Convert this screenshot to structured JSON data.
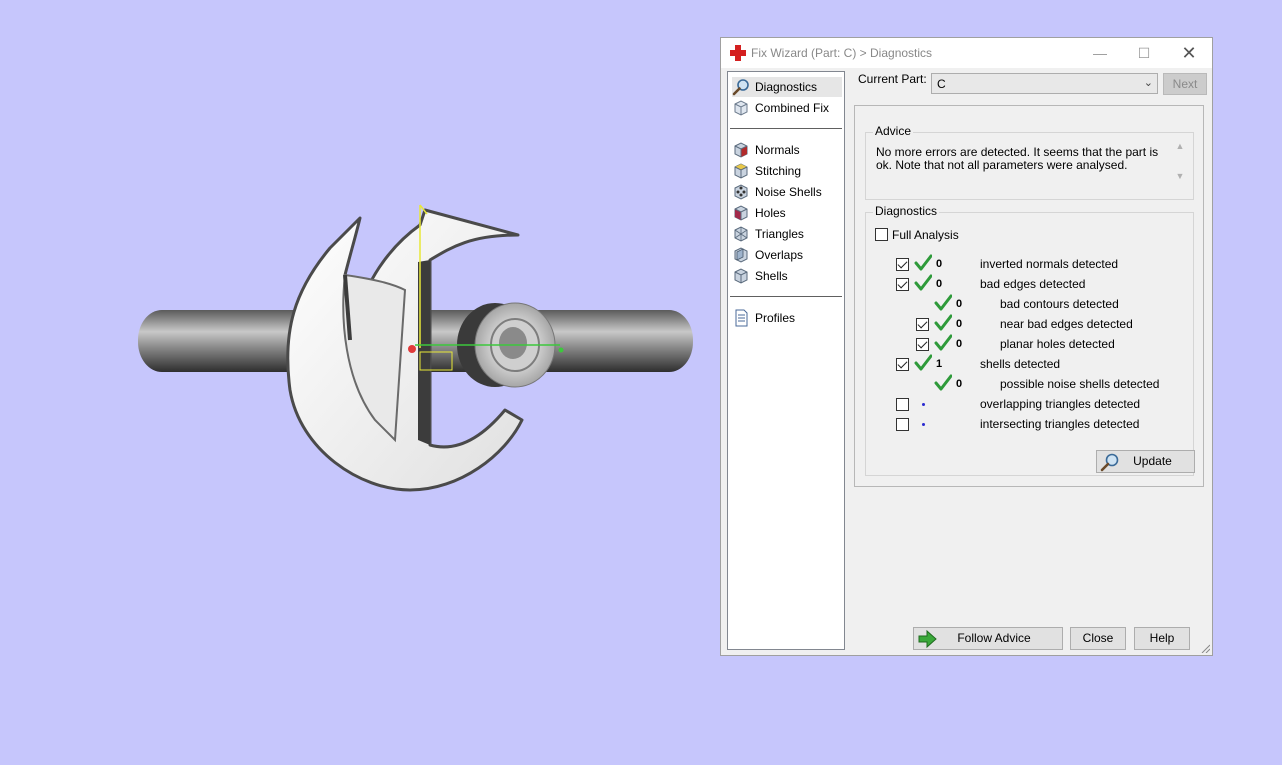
{
  "window": {
    "title": "Fix Wizard (Part: C) > Diagnostics",
    "minimize_glyph": "—",
    "maximize_glyph": "☐",
    "close_glyph": "✕"
  },
  "sidebar": {
    "top_items": [
      {
        "label": "Diagnostics",
        "icon": "magnifier-icon",
        "active": true
      },
      {
        "label": "Combined Fix",
        "icon": "cube-icon"
      }
    ],
    "fix_items": [
      {
        "label": "Normals",
        "icon": "normals-cube-icon"
      },
      {
        "label": "Stitching",
        "icon": "stitching-cube-icon"
      },
      {
        "label": "Noise Shells",
        "icon": "noise-shells-icon"
      },
      {
        "label": "Holes",
        "icon": "holes-cube-icon"
      },
      {
        "label": "Triangles",
        "icon": "triangles-cube-icon"
      },
      {
        "label": "Overlaps",
        "icon": "overlaps-cube-icon"
      },
      {
        "label": "Shells",
        "icon": "shells-cube-icon"
      }
    ],
    "bottom_items": [
      {
        "label": "Profiles",
        "icon": "document-icon"
      }
    ]
  },
  "current_part": {
    "label": "Current Part:",
    "value": "C",
    "next_label": "Next"
  },
  "advice": {
    "title": "Advice",
    "text": "No more errors are detected. It seems that the part is ok. Note that not all parameters were analysed."
  },
  "diagnostics": {
    "title": "Diagnostics",
    "full_analysis_label": "Full Analysis",
    "full_analysis_checked": false,
    "rows": [
      {
        "label": "inverted normals detected",
        "value": "0",
        "checked": true,
        "status": "ok",
        "indent": 0,
        "has_checkbox": true
      },
      {
        "label": "bad edges detected",
        "value": "0",
        "checked": true,
        "status": "ok",
        "indent": 0,
        "has_checkbox": true
      },
      {
        "label": "bad contours detected",
        "value": "0",
        "checked": false,
        "status": "ok",
        "indent": 1,
        "has_checkbox": false
      },
      {
        "label": "near bad edges detected",
        "value": "0",
        "checked": true,
        "status": "ok",
        "indent": 1,
        "has_checkbox": true
      },
      {
        "label": "planar holes detected",
        "value": "0",
        "checked": true,
        "status": "ok",
        "indent": 1,
        "has_checkbox": true
      },
      {
        "label": "shells detected",
        "value": "1",
        "checked": true,
        "status": "ok",
        "indent": 0,
        "has_checkbox": true
      },
      {
        "label": "possible noise shells detected",
        "value": "0",
        "checked": false,
        "status": "ok",
        "indent": 1,
        "has_checkbox": false
      },
      {
        "label": "overlapping triangles detected",
        "value": "",
        "checked": false,
        "status": "pending",
        "indent": 0,
        "has_checkbox": true
      },
      {
        "label": "intersecting triangles detected",
        "value": "",
        "checked": false,
        "status": "pending",
        "indent": 0,
        "has_checkbox": true
      }
    ],
    "update_label": "Update"
  },
  "footer": {
    "follow_advice_label": "Follow Advice",
    "close_label": "Close",
    "help_label": "Help"
  },
  "colors": {
    "viewport_background": "#c6c6fc",
    "check_green": "#2e9a3a",
    "pending_dot": "#2a2ad0"
  }
}
